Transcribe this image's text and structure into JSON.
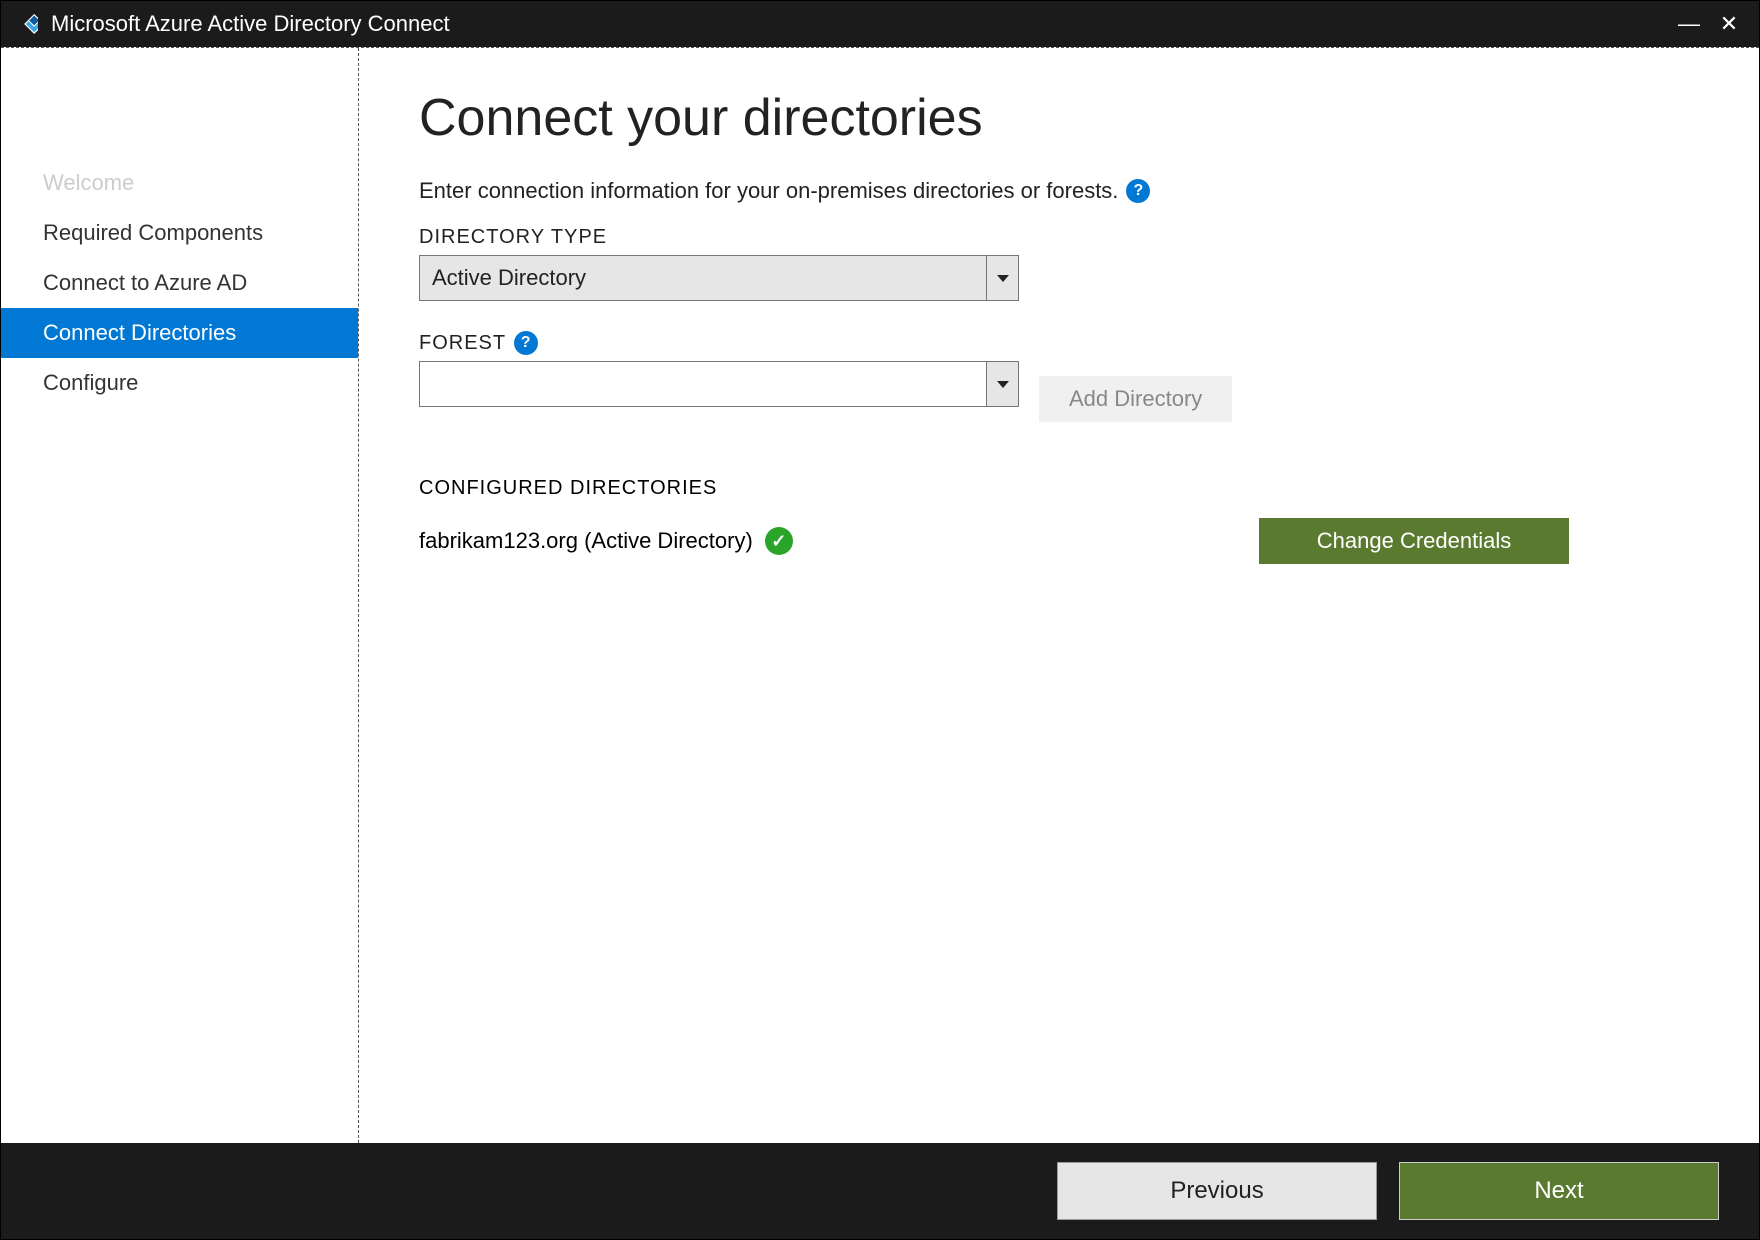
{
  "titlebar": {
    "title": "Microsoft Azure Active Directory Connect"
  },
  "sidebar": {
    "items": [
      {
        "label": "Welcome",
        "state": "disabled"
      },
      {
        "label": "Required Components",
        "state": "normal"
      },
      {
        "label": "Connect to Azure AD",
        "state": "normal"
      },
      {
        "label": "Connect Directories",
        "state": "selected"
      },
      {
        "label": "Configure",
        "state": "normal"
      }
    ]
  },
  "main": {
    "heading": "Connect your directories",
    "subtitle": "Enter connection information for your on-premises directories or forests.",
    "directory_type_label": "DIRECTORY TYPE",
    "directory_type_value": "Active Directory",
    "forest_label": "FOREST",
    "forest_value": "",
    "add_directory_label": "Add Directory",
    "configured_label": "CONFIGURED DIRECTORIES",
    "configured_entry": "fabrikam123.org (Active Directory)",
    "change_credentials_label": "Change Credentials"
  },
  "footer": {
    "previous": "Previous",
    "next": "Next"
  }
}
